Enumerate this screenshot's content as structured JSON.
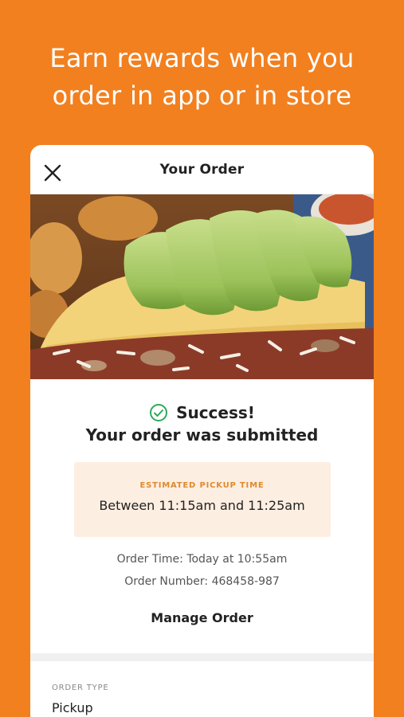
{
  "promo": {
    "line1": "Earn rewards when you",
    "line2": "order in app or in store"
  },
  "header": {
    "title": "Your Order",
    "close_icon": "close-icon"
  },
  "status": {
    "icon": "check-circle-icon",
    "title": "Success!",
    "subtitle": "Your order was submitted"
  },
  "pickup": {
    "label": "ESTIMATED PICKUP TIME",
    "time": "Between 11:15am and 11:25am"
  },
  "order_info": {
    "order_time": "Order Time: Today at 10:55am",
    "order_number": "Order Number: 468458-987"
  },
  "actions": {
    "manage_label": "Manage Order"
  },
  "order_type": {
    "label": "ORDER TYPE",
    "value": "Pickup"
  },
  "colors": {
    "background": "#f2801f",
    "accent": "#e08a2c",
    "success": "#2eaa5a",
    "pickup_box": "#fdeee2"
  }
}
